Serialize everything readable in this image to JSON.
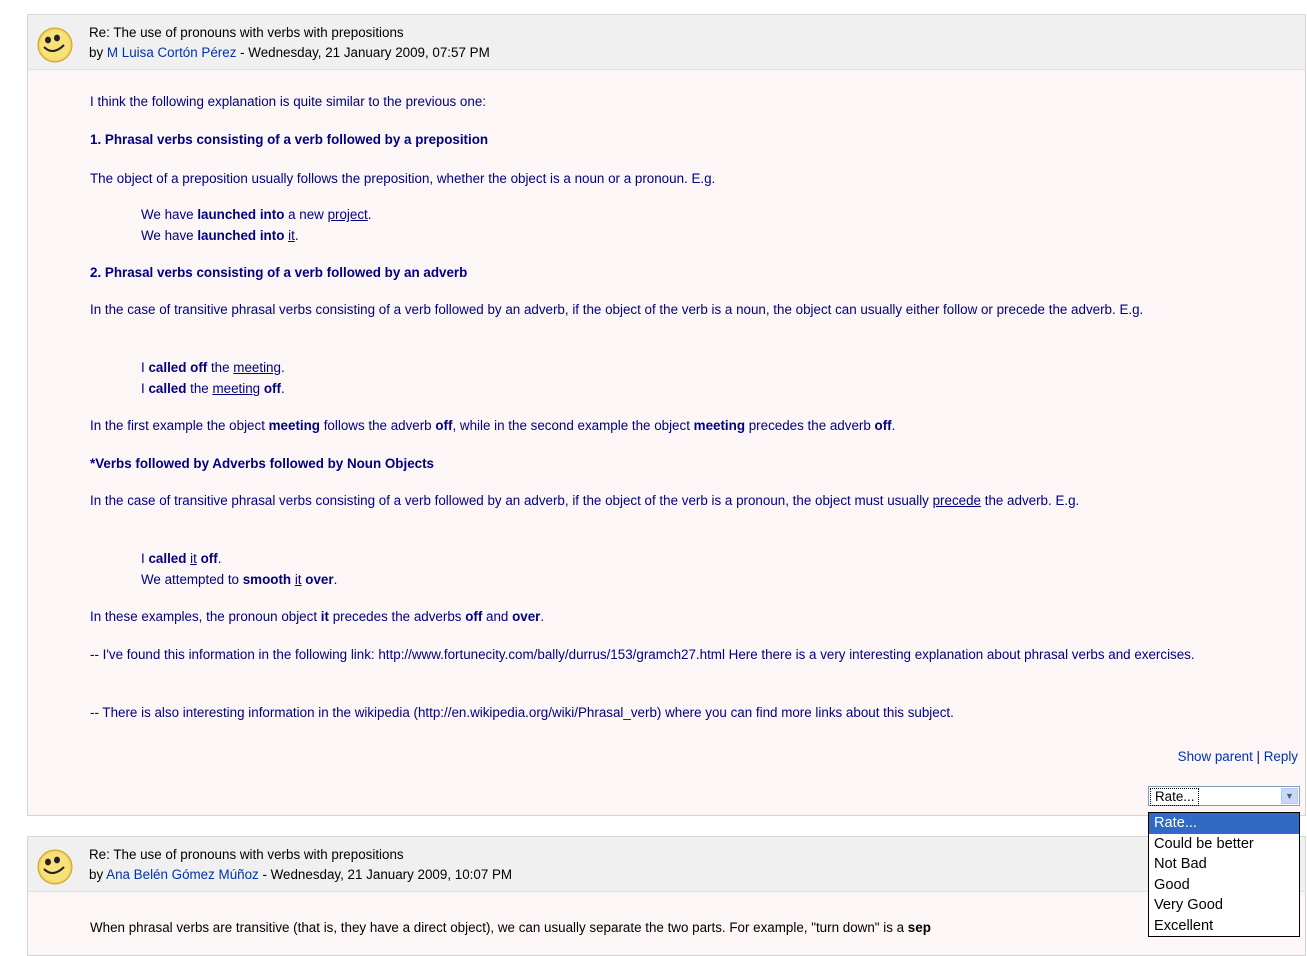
{
  "post1": {
    "subject": "Re: The use of pronouns with verbs with prepositions",
    "by": "by",
    "author": "M Luisa Cortón Pérez",
    "date_sep": " - ",
    "date": "Wednesday, 21 January 2009, 07:57 PM",
    "intro": "I think the following explanation is quite similar to the previous one:",
    "h1": "1. Phrasal verbs consisting of a verb followed by a preposition",
    "p1": "The object of a preposition usually follows the preposition, whether the object is a noun or a pronoun. E.g.",
    "ex1a": [
      "We have ",
      "launched into",
      " a new ",
      "project",
      "."
    ],
    "ex1b": [
      "We have ",
      "launched into",
      " ",
      "it",
      "."
    ],
    "h2": "2. Phrasal verbs consisting of a verb followed by an adverb",
    "p2": "In the case of transitive phrasal verbs consisting of a verb followed by an adverb, if the object of the verb is a noun, the object can usually either follow or precede the adverb. E.g.",
    "ex2a": [
      "I ",
      "called off",
      " the ",
      "meeting",
      "."
    ],
    "ex2b": [
      "I ",
      "called",
      " the ",
      "meeting",
      " ",
      "off",
      "."
    ],
    "p3": [
      "In the first example the object ",
      "meeting",
      " follows the adverb ",
      "off",
      ", while in the second example the object ",
      "meeting",
      " precedes the adverb ",
      "off",
      "."
    ],
    "h3": "*Verbs followed by Adverbs followed by Noun Objects",
    "p4": [
      "In the case of transitive phrasal verbs consisting of a verb followed by an adverb, if the object of the verb is a pronoun, the object must usually ",
      "precede",
      " the adverb. E.g."
    ],
    "ex3a": [
      "I ",
      "called",
      " ",
      "it",
      " ",
      "off",
      "."
    ],
    "ex3b": [
      "We attempted to ",
      "smooth",
      " ",
      "it",
      " ",
      "over",
      "."
    ],
    "p5": [
      "In these examples, the pronoun object ",
      "it",
      " precedes the adverbs ",
      "off",
      " and ",
      "over",
      "."
    ],
    "p6": "-- I've found this information in the following link: http://www.fortunecity.com/bally/durrus/153/gramch27.html Here there is a very interesting explanation about phrasal verbs and exercises.",
    "p7": "-- There is also interesting information in the wikipedia  (http://en.wikipedia.org/wiki/Phrasal_verb) where you can find more links about this subject.",
    "show_parent": "Show parent",
    "cmd_sep": " | ",
    "reply": "Reply",
    "rate_selected": "Rate..."
  },
  "rate_options": [
    "Rate...",
    "Could be better",
    "Not Bad",
    "Good",
    "Very Good",
    "Excellent"
  ],
  "post2": {
    "subject": "Re: The use of pronouns with verbs with prepositions",
    "by": "by",
    "author": "Ana Belén Gómez Múñoz",
    "date_sep": " - ",
    "date": "Wednesday, 21 January 2009, 10:07 PM",
    "body": [
      "When phrasal verbs are transitive (that is, they have a direct object), we can usually separate the two parts. For example, \"turn down\" is a ",
      "sep"
    ]
  }
}
